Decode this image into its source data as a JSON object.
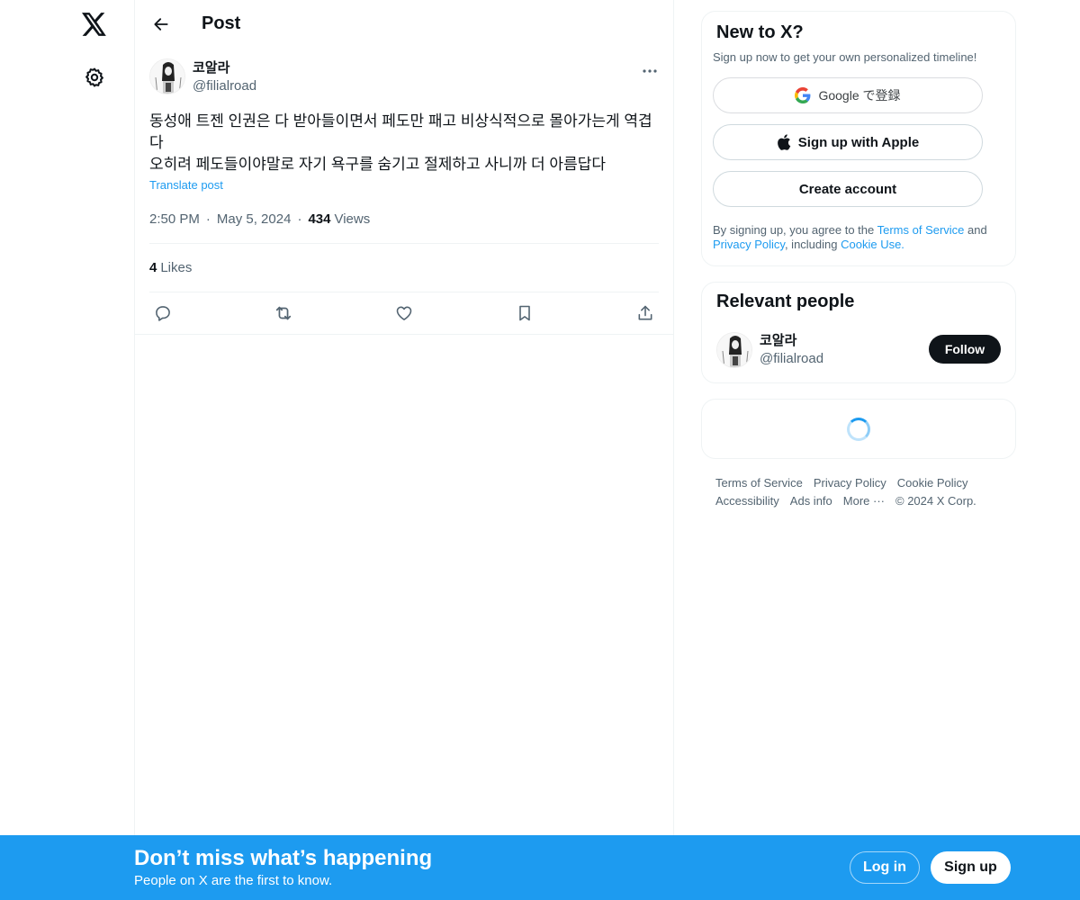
{
  "nav": {
    "logo_icon": "x-logo-icon",
    "settings_icon": "gear-icon"
  },
  "header": {
    "title": "Post",
    "back_icon": "arrow-left-icon"
  },
  "post": {
    "display_name": "코알라",
    "handle": "@filialroad",
    "text_lines": [
      "동성애 트젠 인권은 다 받아들이면서 페도만 패고 비상식적으로 몰아가는게 역겹다",
      "오히려 페도들이야말로 자기 욕구를 숨기고 절제하고 사니까 더 아름답다"
    ],
    "translate_label": "Translate post",
    "time": "2:50 PM",
    "date": "May 5, 2024",
    "views_count": "434",
    "views_label": "Views",
    "likes_count": "4",
    "likes_label": "Likes",
    "action_icons": [
      "reply-icon",
      "retweet-icon",
      "like-icon",
      "bookmark-icon",
      "share-icon"
    ]
  },
  "signup_card": {
    "title": "New to X?",
    "subtitle": "Sign up now to get your own personalized timeline!",
    "google_label": "Google で登録",
    "apple_label": "Sign up with Apple",
    "create_label": "Create account",
    "legal_prefix": "By signing up, you agree to the ",
    "terms_link": "Terms of Service",
    "legal_and": " and ",
    "privacy_link": "Privacy Policy",
    "legal_including": ", including ",
    "cookie_link": "Cookie Use."
  },
  "relevant_people": {
    "title": "Relevant people",
    "person": {
      "display_name": "코알라",
      "handle": "@filialroad",
      "follow_label": "Follow"
    }
  },
  "footer": {
    "links": [
      "Terms of Service",
      "Privacy Policy",
      "Cookie Policy",
      "Accessibility",
      "Ads info",
      "More ···"
    ],
    "copyright": "© 2024 X Corp."
  },
  "banner": {
    "title": "Don’t miss what’s happening",
    "subtitle": "People on X are the first to know.",
    "login_label": "Log in",
    "signup_label": "Sign up"
  },
  "colors": {
    "accent": "#1d9bf0",
    "text": "#0f1419",
    "muted": "#536471",
    "border": "#eff3f4"
  }
}
